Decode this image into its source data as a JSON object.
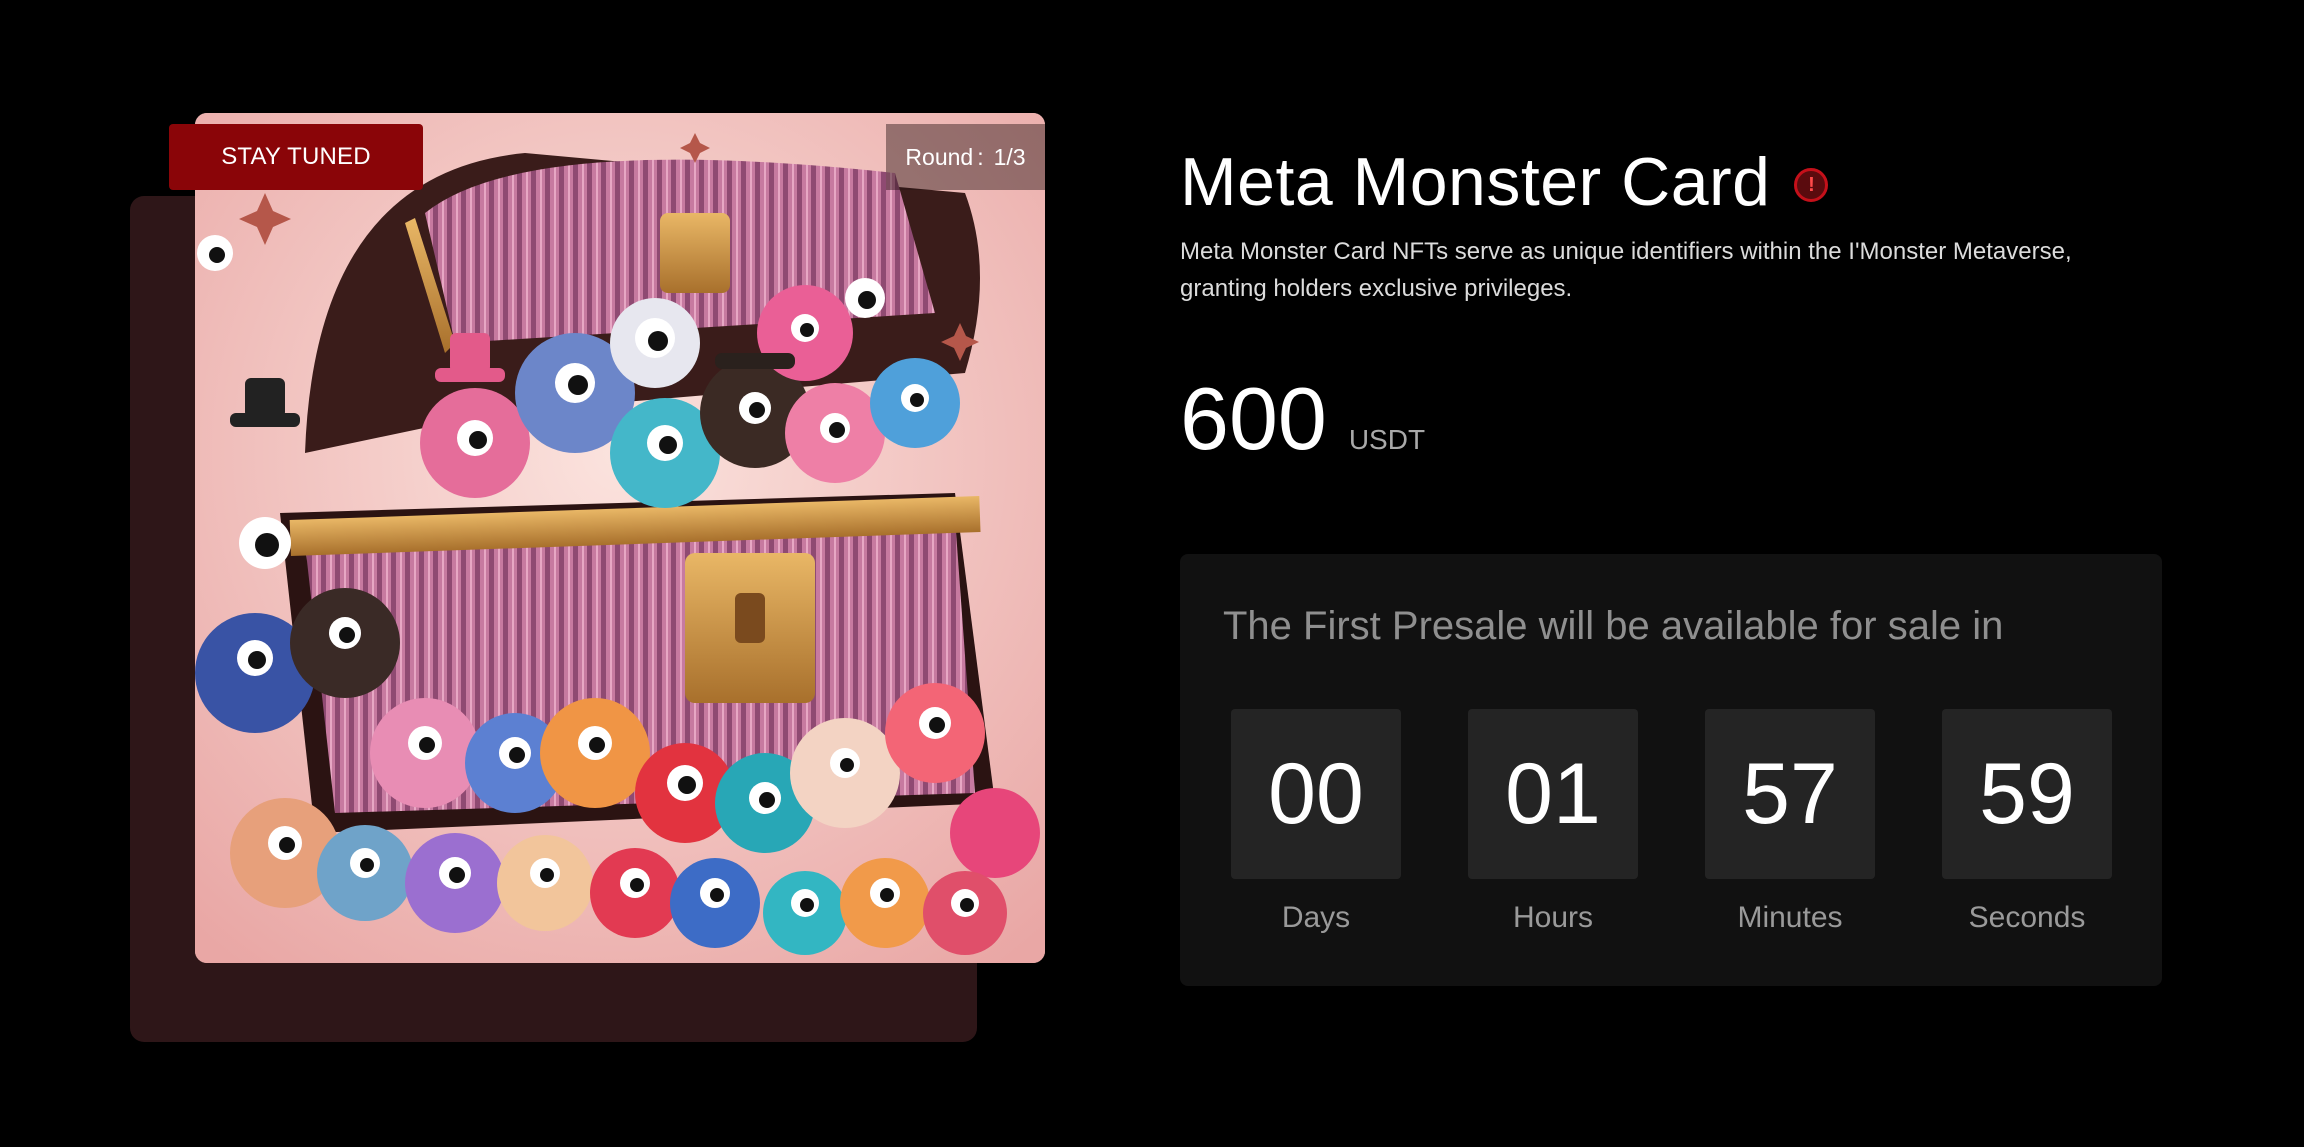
{
  "badge": {
    "status": "STAY TUNED",
    "round_label": "Round",
    "round_sep": ":",
    "round_value": "1/3"
  },
  "product": {
    "title": "Meta Monster Card",
    "info_icon": "alert-circle-icon",
    "description": "Meta Monster Card NFTs serve as unique identifiers within the I'Monster Metaverse, granting holders exclusive privileges.",
    "price": "600",
    "currency": "USDT"
  },
  "countdown": {
    "heading": "The First Presale will be available for sale in",
    "units": [
      {
        "value": "00",
        "label": "Days"
      },
      {
        "value": "01",
        "label": "Hours"
      },
      {
        "value": "57",
        "label": "Minutes"
      },
      {
        "value": "59",
        "label": "Seconds"
      }
    ]
  },
  "colors": {
    "background": "#000000",
    "accent": "#8a0508",
    "card": "#111111",
    "digit_box": "#242424",
    "back_panel": "#2e1618"
  }
}
